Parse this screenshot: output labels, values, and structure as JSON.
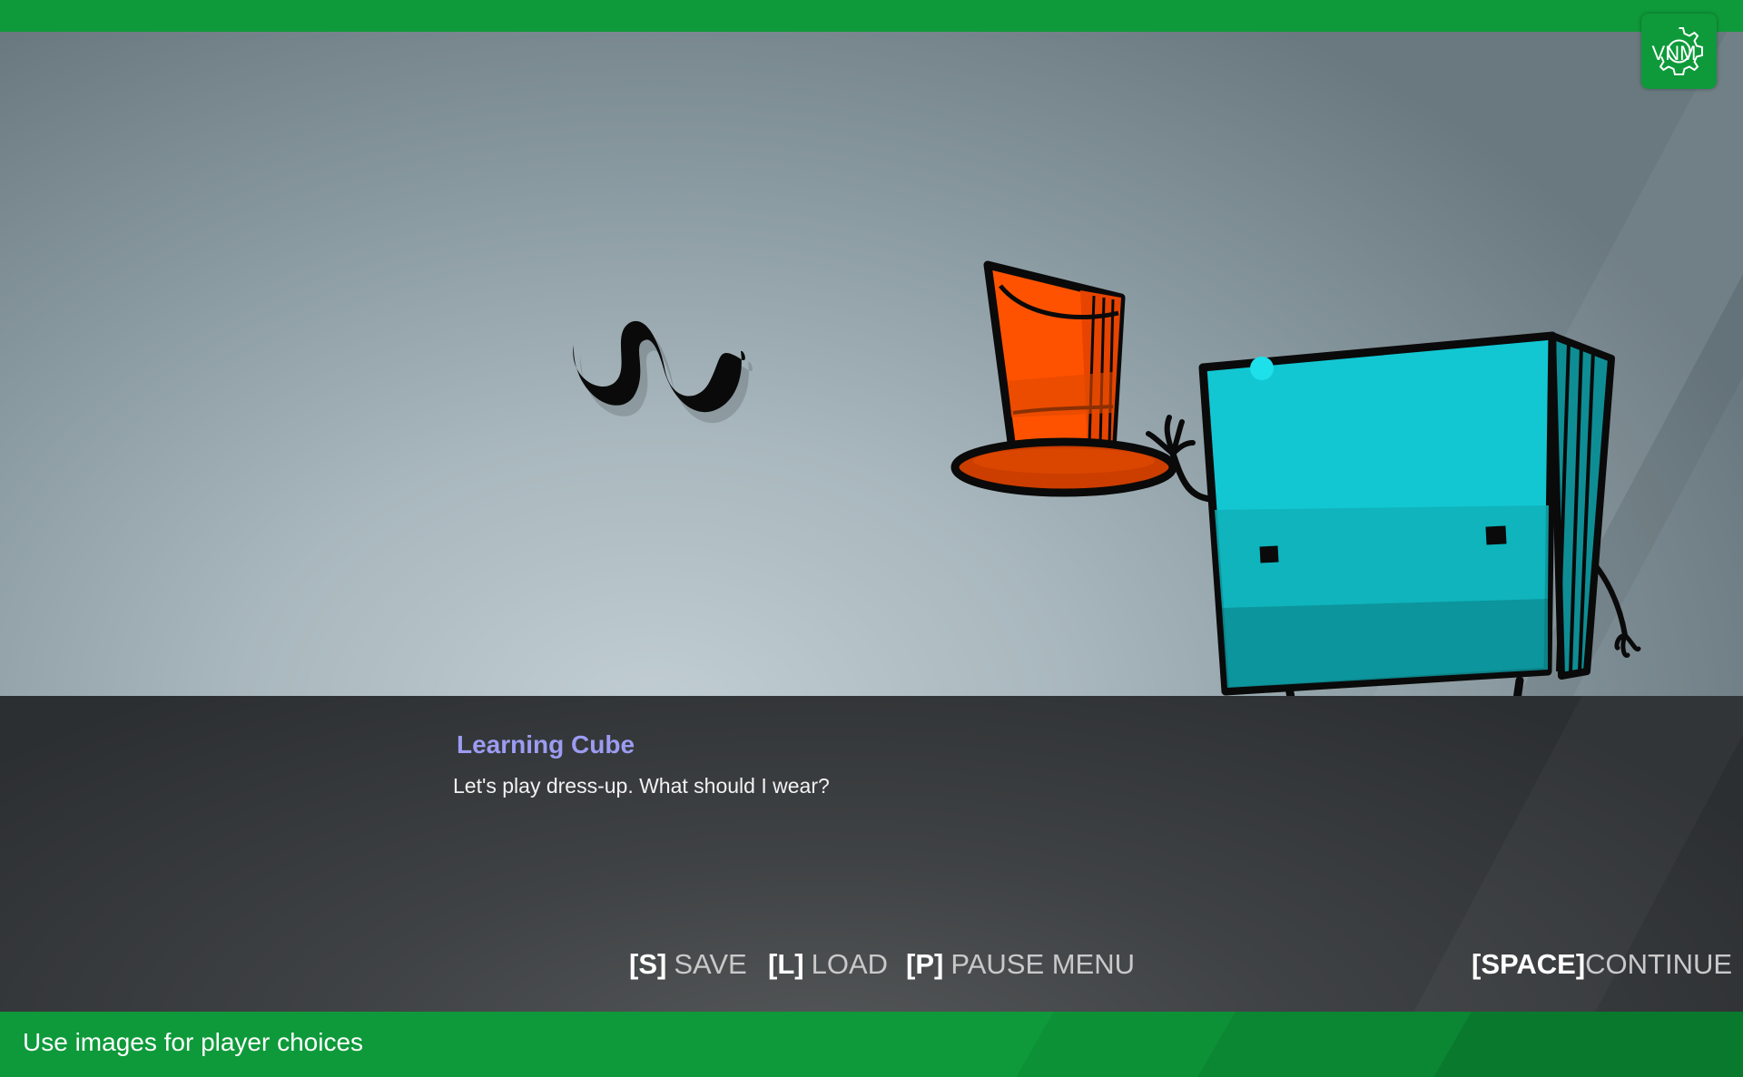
{
  "scene": {
    "items": [
      "mustache",
      "top-hat"
    ],
    "character": "learning-cube"
  },
  "dialog": {
    "speaker": "Learning Cube",
    "text": "Let's play dress-up. What should I wear?"
  },
  "controls": {
    "save": {
      "key": "[S]",
      "label": "SAVE"
    },
    "load": {
      "key": "[L]",
      "label": "LOAD"
    },
    "pause": {
      "key": "[P]",
      "label": "PAUSE MENU"
    },
    "continue": {
      "key": "[SPACE]",
      "label": "CONTINUE"
    }
  },
  "footer": {
    "caption": "Use images for player choices"
  },
  "logo": {
    "text": "VNM"
  },
  "colors": {
    "accent_green": "#0e9a3a",
    "speaker_name": "#9c9cf2",
    "cube": "#12c7d2",
    "hat": "#ff5200"
  }
}
